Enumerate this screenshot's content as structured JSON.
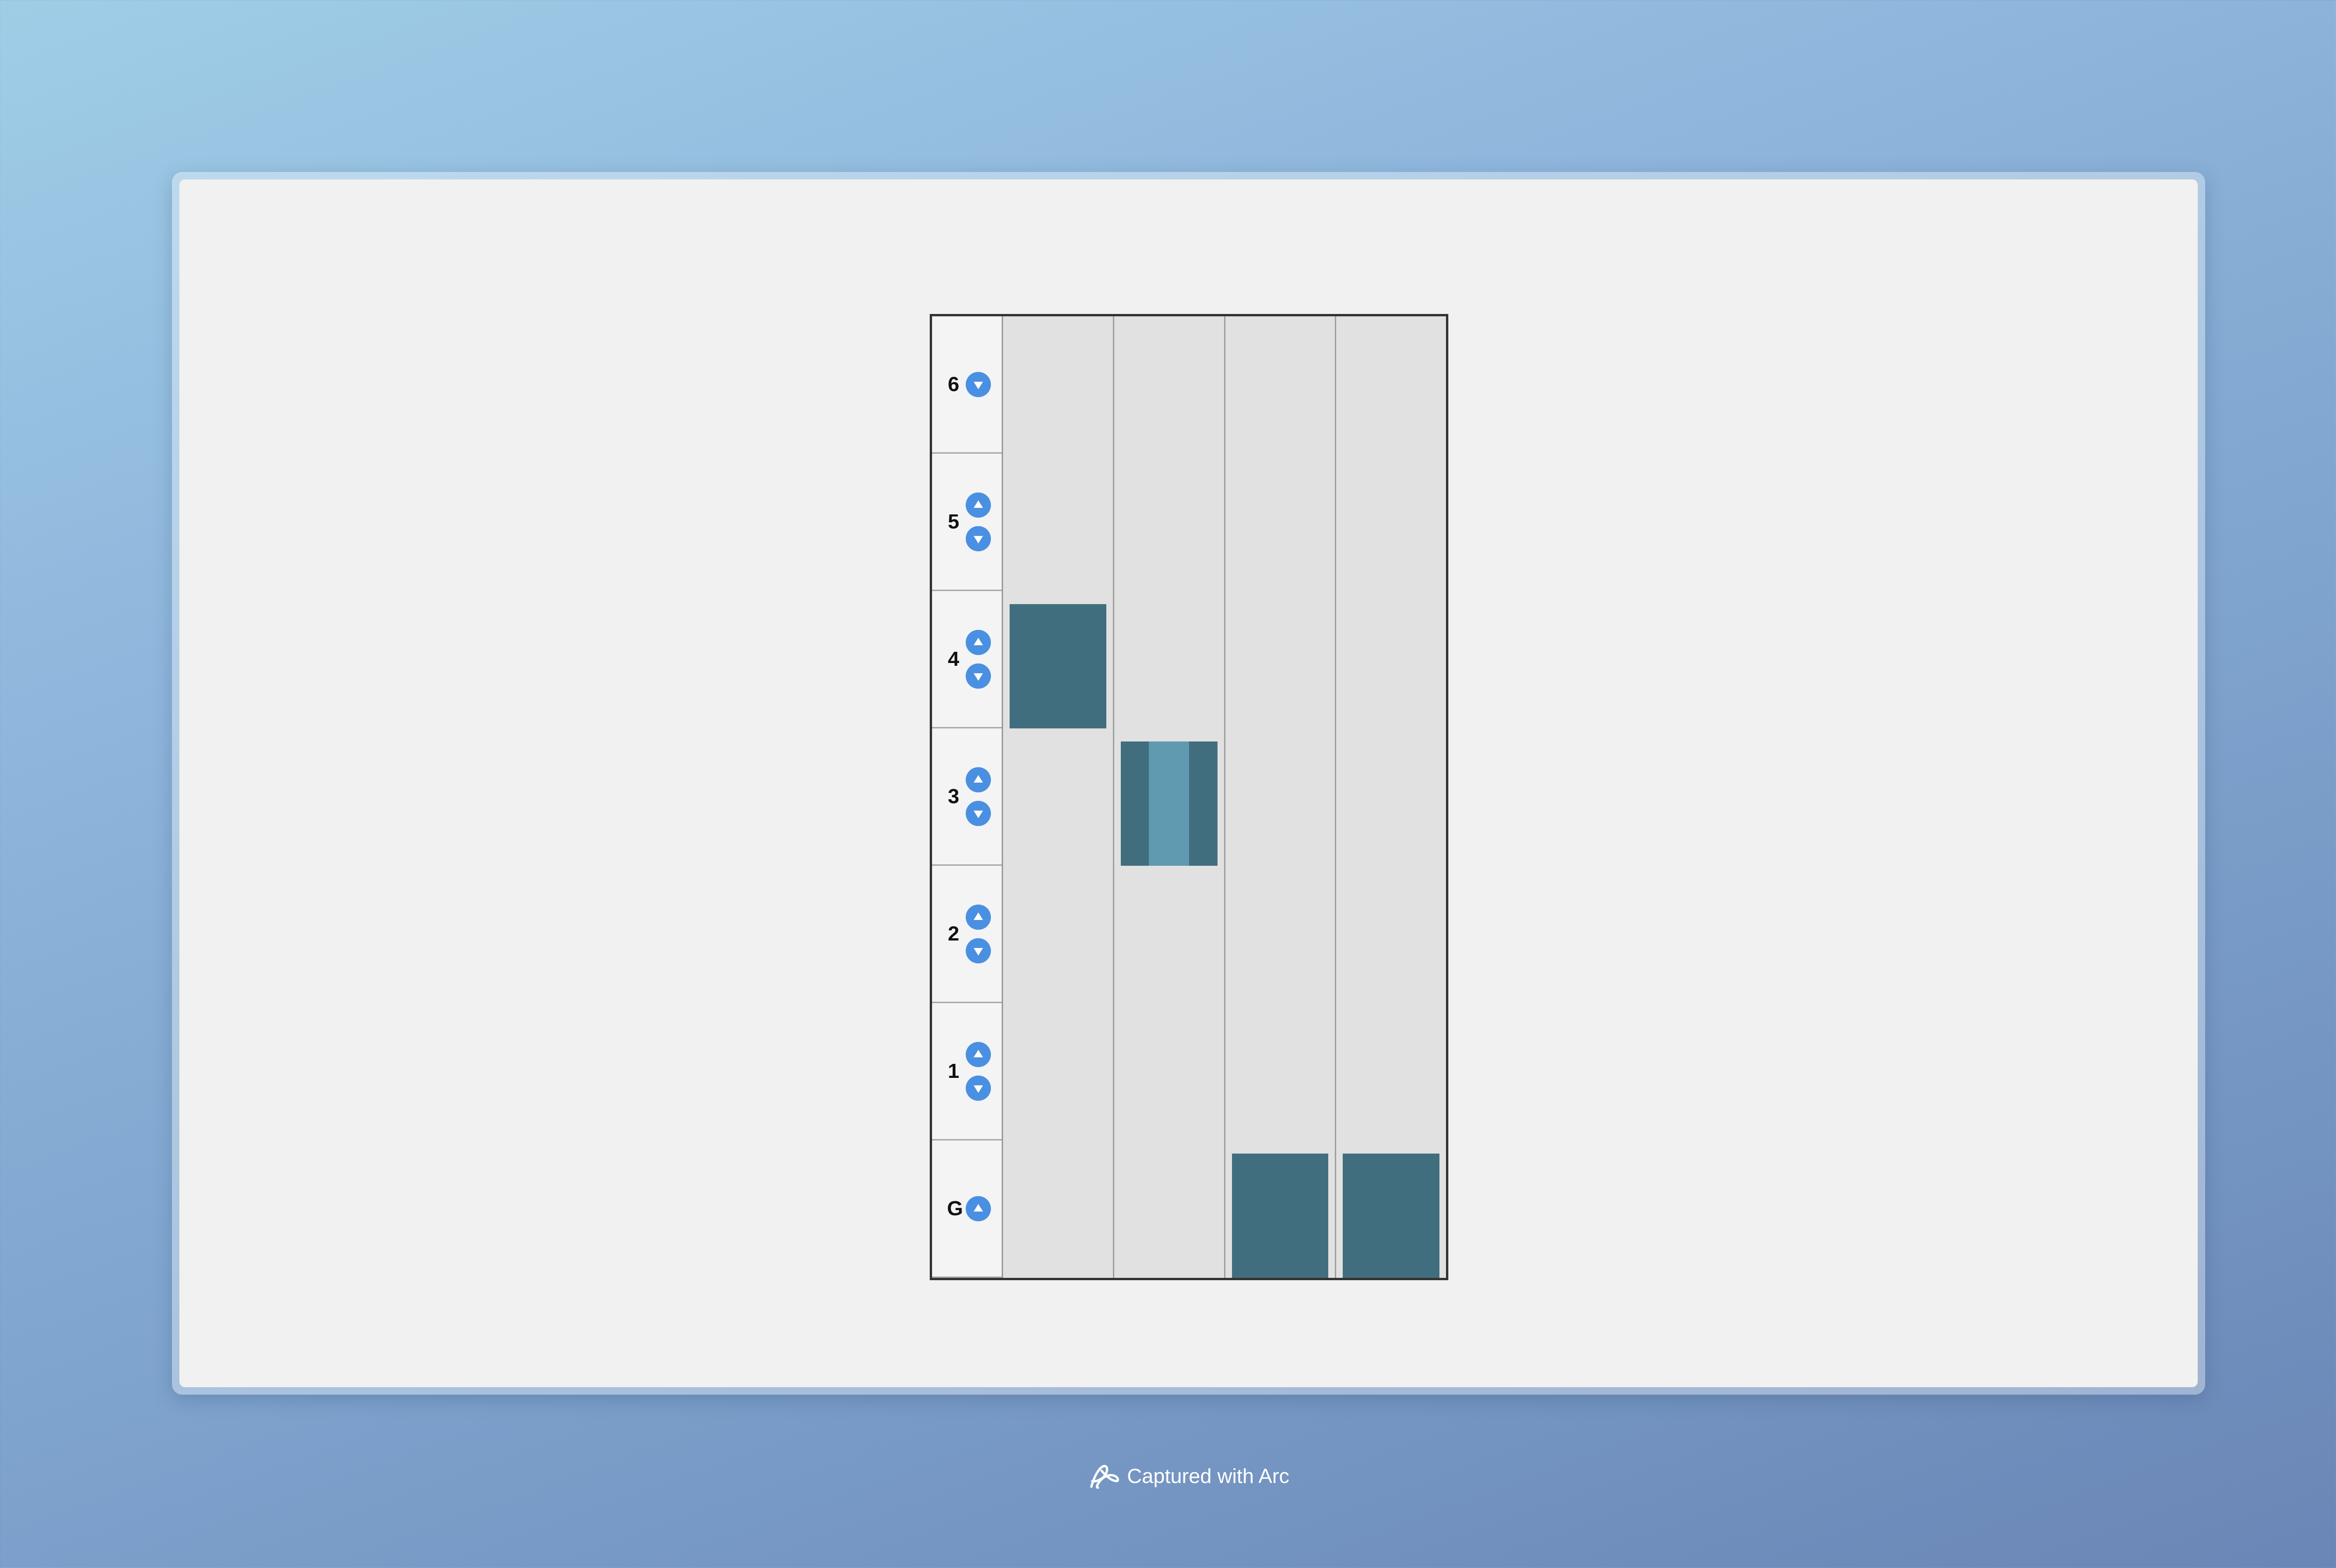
{
  "floors": [
    {
      "label": "6",
      "up": false,
      "down": true
    },
    {
      "label": "5",
      "up": true,
      "down": true
    },
    {
      "label": "4",
      "up": true,
      "down": true
    },
    {
      "label": "3",
      "up": true,
      "down": true
    },
    {
      "label": "2",
      "up": true,
      "down": true
    },
    {
      "label": "1",
      "up": true,
      "down": true
    },
    {
      "label": "G",
      "up": true,
      "down": false
    }
  ],
  "elevators": [
    {
      "floor": "4",
      "doors": "closed"
    },
    {
      "floor": "3",
      "doors": "opening"
    },
    {
      "floor": "G",
      "doors": "closed"
    },
    {
      "floor": "G",
      "doors": "closed"
    }
  ],
  "colors": {
    "car": "#416e7e",
    "door_gap": "#5f9ab0",
    "button": "#4a90e2"
  },
  "footer": {
    "icon": "arc-logo-icon",
    "text": "Captured with Arc"
  }
}
